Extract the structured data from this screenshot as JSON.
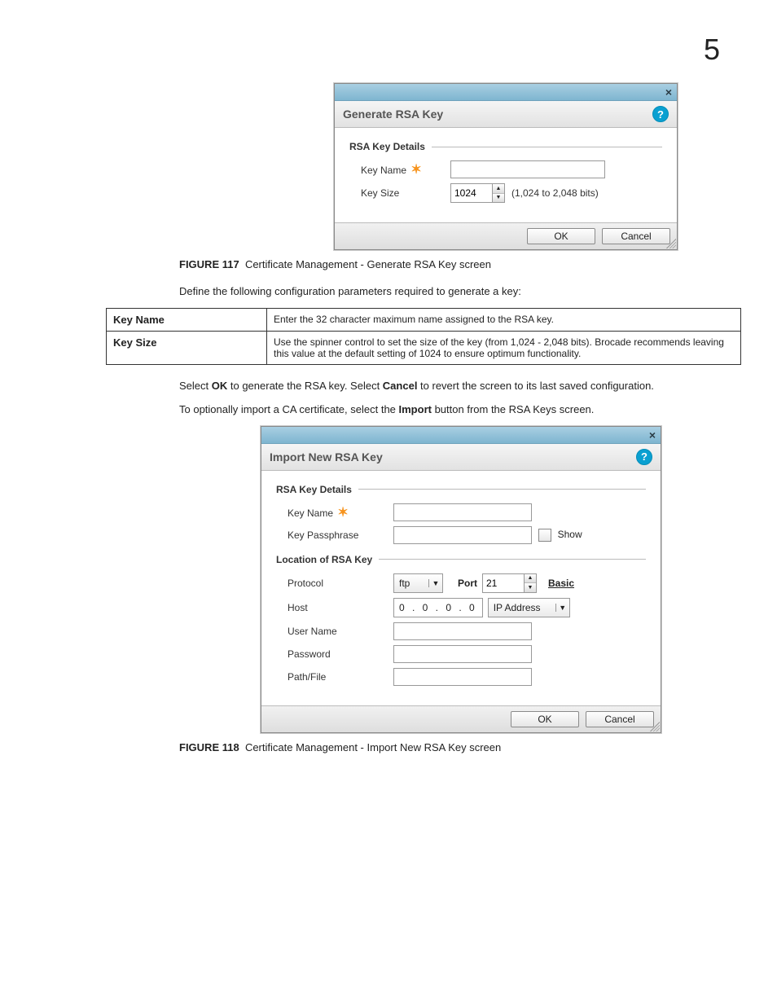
{
  "page_number": "5",
  "dialog1": {
    "title": "Generate RSA Key",
    "section": "RSA Key Details",
    "key_name_label": "Key Name",
    "key_size_label": "Key Size",
    "key_size_value": "1024",
    "key_size_hint": "(1,024 to 2,048 bits)",
    "ok": "OK",
    "cancel": "Cancel"
  },
  "figure1": {
    "num": "FIGURE 117",
    "caption": "Certificate Management - Generate RSA Key screen"
  },
  "para1": "Define the following configuration parameters required to generate a key:",
  "table": {
    "r1k": "Key Name",
    "r1v": "Enter the 32 character maximum name assigned to the RSA key.",
    "r2k": "Key Size",
    "r2v": "Use the spinner control to set the size of the key (from 1,024 - 2,048 bits). Brocade recommends leaving this value at the default setting of 1024 to ensure optimum functionality."
  },
  "para2a": "Select ",
  "para2b": "OK",
  "para2c": " to generate the RSA key. Select ",
  "para2d": "Cancel",
  "para2e": " to revert the screen to its last saved configuration.",
  "para3a": "To optionally import a CA certificate, select the ",
  "para3b": "Import",
  "para3c": " button from the RSA Keys screen.",
  "dialog2": {
    "title": "Import New RSA Key",
    "section1": "RSA Key Details",
    "key_name_label": "Key Name",
    "key_pass_label": "Key Passphrase",
    "show": "Show",
    "section2": "Location of RSA Key",
    "protocol_label": "Protocol",
    "protocol_value": "ftp",
    "port_label": "Port",
    "port_value": "21",
    "basic": "Basic",
    "host_label": "Host",
    "host_ip": "0 . 0 . 0 . 0",
    "ip_type": "IP Address",
    "user_label": "User Name",
    "password_label": "Password",
    "path_label": "Path/File",
    "ok": "OK",
    "cancel": "Cancel"
  },
  "figure2": {
    "num": "FIGURE 118",
    "caption": "Certificate Management - Import New RSA Key screen"
  }
}
